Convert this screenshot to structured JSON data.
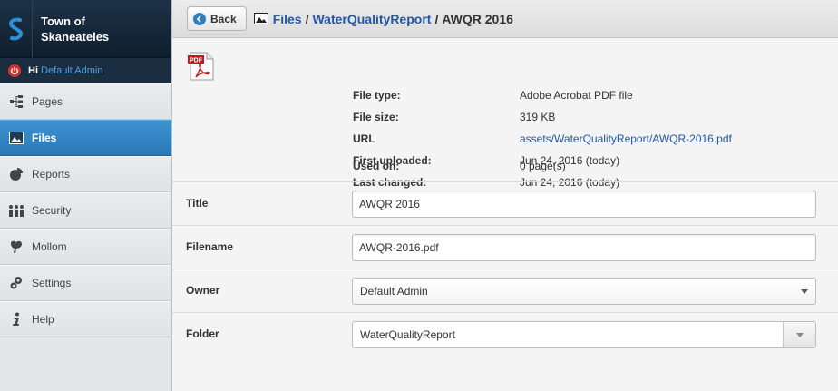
{
  "brand": {
    "line1": "Town of",
    "line2": "Skaneateles"
  },
  "session": {
    "greeting": "Hi",
    "user": "Default Admin"
  },
  "nav": [
    {
      "label": "Pages",
      "icon": "sitemap-icon"
    },
    {
      "label": "Files",
      "icon": "image-icon"
    },
    {
      "label": "Reports",
      "icon": "pie-chart-icon"
    },
    {
      "label": "Security",
      "icon": "users-icon"
    },
    {
      "label": "Mollom",
      "icon": "leaf-icon"
    },
    {
      "label": "Settings",
      "icon": "gears-icon"
    },
    {
      "label": "Help",
      "icon": "info-icon"
    }
  ],
  "toolbar": {
    "back_label": "Back"
  },
  "breadcrumb": {
    "files": "Files",
    "separator": "/",
    "folder": "WaterQualityReport",
    "current": "AWQR 2016"
  },
  "file_info": {
    "icon_text": "PDF",
    "type_label": "File type:",
    "type_value": "Adobe Acrobat PDF file",
    "size_label": "File size:",
    "size_value": "319 KB",
    "url_label": "URL",
    "url_value": "assets/WaterQualityReport/AWQR-2016.pdf",
    "uploaded_label": "First uploaded:",
    "uploaded_value": "Jun 24, 2016 (today)",
    "changed_label": "Last changed:",
    "changed_value": "Jun 24, 2016 (today)",
    "used_label": "Used on:",
    "used_value": "0 page(s)"
  },
  "form": {
    "title_label": "Title",
    "title_value": "AWQR 2016",
    "filename_label": "Filename",
    "filename_value": "AWQR-2016.pdf",
    "owner_label": "Owner",
    "owner_value": "Default Admin",
    "folder_label": "Folder",
    "folder_value": "WaterQualityReport"
  },
  "colors": {
    "accent": "#2a78b8",
    "link": "#2356a5",
    "sidebar_dark": "#1b2d40"
  }
}
